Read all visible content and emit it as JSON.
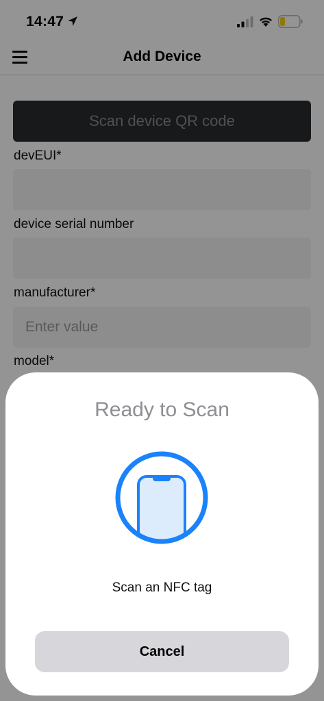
{
  "status_bar": {
    "time": "14:47",
    "icons": [
      "location-arrow-icon",
      "cellular-signal-icon",
      "wifi-icon",
      "battery-icon"
    ],
    "battery_color": "#f4d20b"
  },
  "nav": {
    "title": "Add Device",
    "menu_icon": "hamburger-menu-icon"
  },
  "form": {
    "scan_qr_label": "Scan device QR code",
    "fields": [
      {
        "label": "devEUI*",
        "value": "",
        "placeholder": ""
      },
      {
        "label": "device serial number",
        "value": "",
        "placeholder": ""
      },
      {
        "label": "manufacturer*",
        "value": "",
        "placeholder": "Enter value"
      },
      {
        "label": "model*"
      }
    ]
  },
  "nfc_sheet": {
    "title": "Ready to Scan",
    "graphic": "nfc-phone-icon",
    "message": "Scan an NFC tag",
    "cancel_label": "Cancel",
    "accent_color": "#1a82fb"
  }
}
